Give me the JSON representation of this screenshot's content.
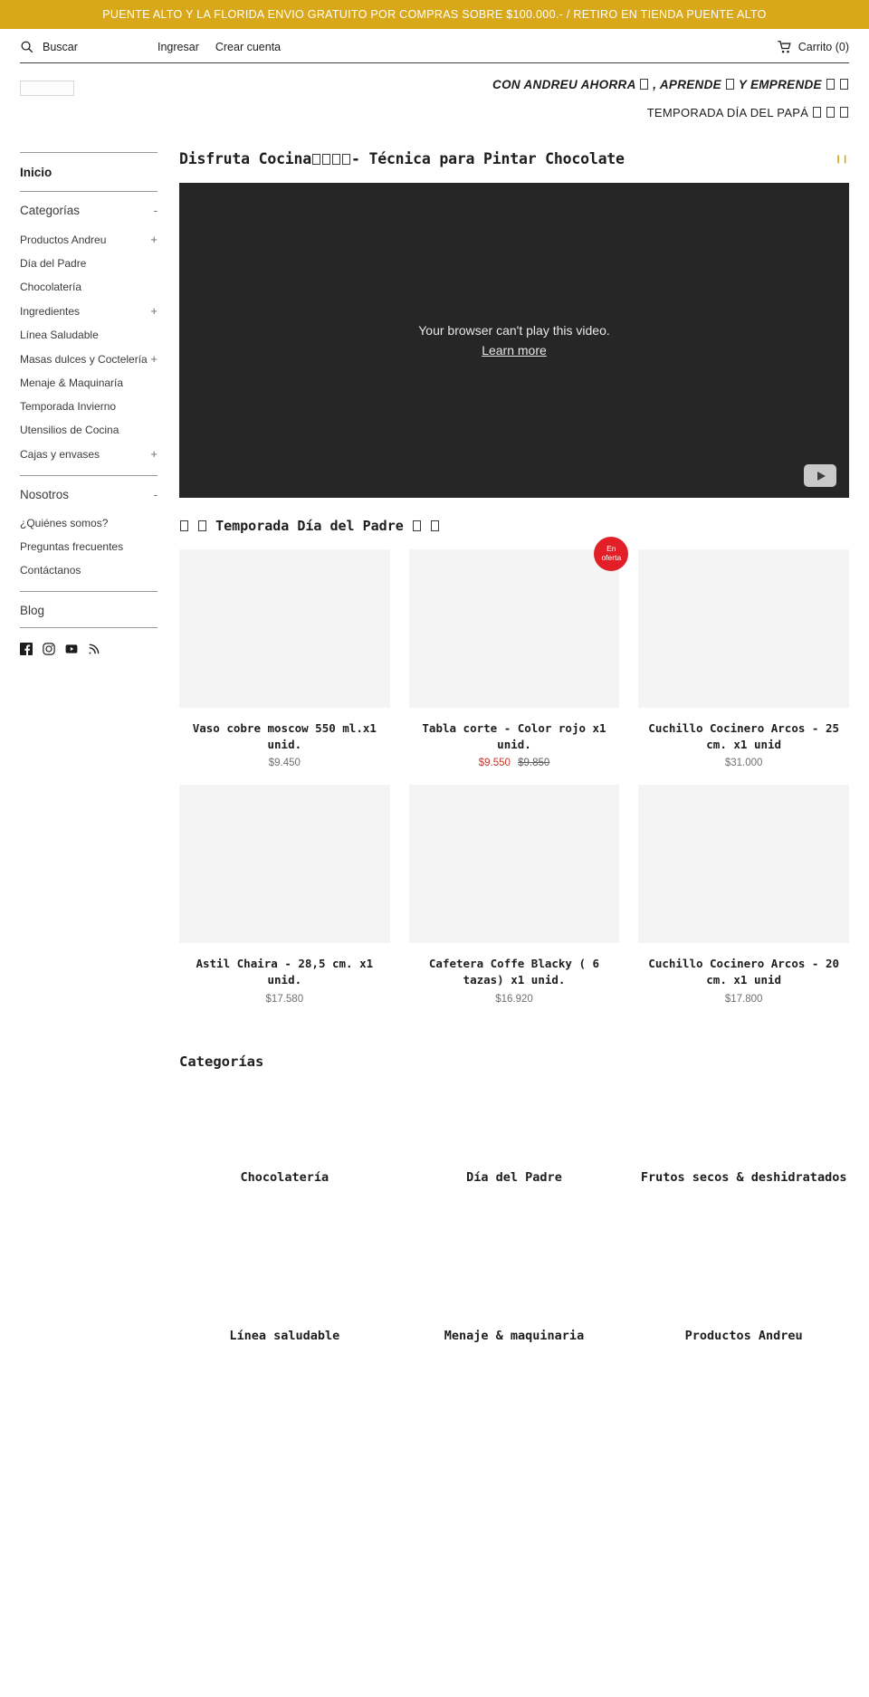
{
  "announcement": {
    "text": "PUENTE ALTO Y LA FLORIDA ENVIO GRATUITO POR COMPRAS SOBRE $100.000.- / RETIRO EN TIENDA PUENTE ALTO",
    "background_color": "#d9a81a"
  },
  "topbar": {
    "search_label": "Buscar",
    "login_label": "Ingresar",
    "create_account_label": "Crear cuenta",
    "cart_label": "Carrito (0)"
  },
  "brand": {
    "slogan_main_part1": "CON ANDREU AHORRA",
    "slogan_main_part2": ", APRENDE",
    "slogan_main_part3": " Y EMPRENDE",
    "slogan_sub": "TEMPORADA DÍA DEL PAPÁ"
  },
  "sidebar": {
    "home_label": "Inicio",
    "categories_title": "Categorías",
    "categories_sign": "-",
    "categories": [
      {
        "label": "Productos Andreu",
        "sign": "+"
      },
      {
        "label": "Día del Padre",
        "sign": ""
      },
      {
        "label": "Chocolatería",
        "sign": ""
      },
      {
        "label": "Ingredientes",
        "sign": "+"
      },
      {
        "label": "Línea Saludable",
        "sign": ""
      },
      {
        "label": "Masas dulces y Coctelería",
        "sign": "+"
      },
      {
        "label": "Menaje & Maquinaría",
        "sign": ""
      },
      {
        "label": "Temporada Invierno",
        "sign": ""
      },
      {
        "label": "Utensilios de Cocina",
        "sign": ""
      },
      {
        "label": "Cajas y envases",
        "sign": "+"
      }
    ],
    "about_title": "Nosotros",
    "about_sign": "-",
    "about_items": [
      {
        "label": "¿Quiénes somos?"
      },
      {
        "label": "Preguntas frecuentes"
      },
      {
        "label": "Contáctanos"
      }
    ],
    "blog_label": "Blog",
    "social": [
      {
        "name": "facebook-icon"
      },
      {
        "name": "instagram-icon"
      },
      {
        "name": "youtube-icon"
      },
      {
        "name": "rss-icon"
      }
    ]
  },
  "video": {
    "heading_prefix": "Disfruta Cocina ",
    "heading_suffix": " - Técnica para Pintar Chocolate",
    "pause_icon": "❙❙",
    "error_text": "Your browser can't play this video.",
    "learn_more": "Learn more"
  },
  "products_section": {
    "title_text": "Temporada Día del Padre",
    "items": [
      {
        "name": "Vaso cobre moscow 550 ml.x1 unid.",
        "price": "$9.450",
        "sale": false,
        "old_price": ""
      },
      {
        "name": "Tabla corte - Color rojo x1 unid.",
        "price": "$9.550",
        "sale": true,
        "old_price": "$9.850",
        "badge_line1": "En",
        "badge_line2": "oferta"
      },
      {
        "name": "Cuchillo Cocinero Arcos - 25 cm. x1 unid",
        "price": "$31.000",
        "sale": false,
        "old_price": ""
      },
      {
        "name": "Astil Chaira - 28,5 cm. x1 unid.",
        "price": "$17.580",
        "sale": false,
        "old_price": ""
      },
      {
        "name": "Cafetera Coffe Blacky ( 6 tazas) x1 unid.",
        "price": "$16.920",
        "sale": false,
        "old_price": ""
      },
      {
        "name": "Cuchillo Cocinero Arcos - 20 cm. x1 unid",
        "price": "$17.800",
        "sale": false,
        "old_price": ""
      }
    ]
  },
  "categories_section": {
    "title": "Categorías",
    "items": [
      {
        "label": "Chocolatería"
      },
      {
        "label": "Día del Padre"
      },
      {
        "label": "Frutos secos & deshidratados"
      },
      {
        "label": "Línea saludable"
      },
      {
        "label": "Menaje & maquinaria"
      },
      {
        "label": "Productos Andreu"
      }
    ]
  }
}
